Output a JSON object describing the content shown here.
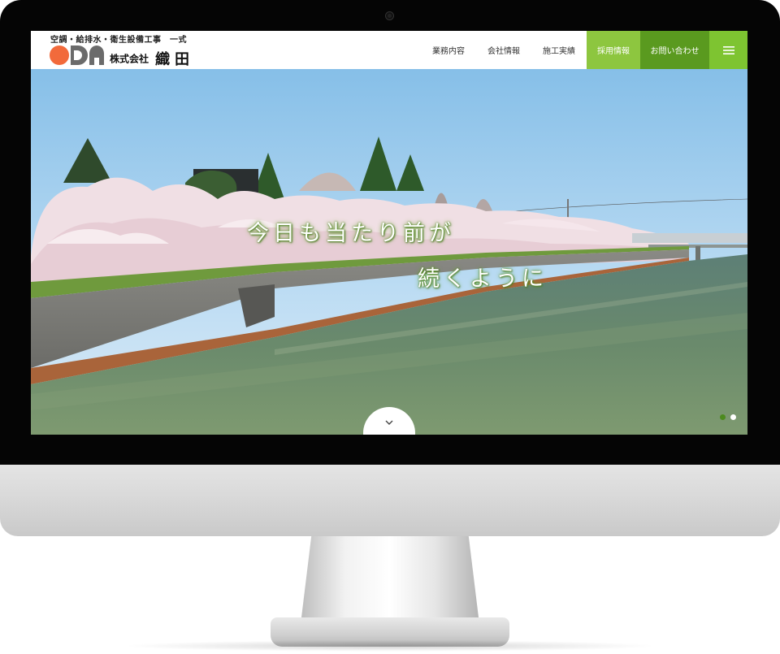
{
  "site": {
    "tagline": "空調・給排水・衛生設備工事　一式",
    "logo_text": "ODA",
    "company_prefix": "株式会社",
    "company_name": "織田"
  },
  "nav": {
    "items": [
      {
        "label": "業務内容"
      },
      {
        "label": "会社情報"
      },
      {
        "label": "施工実績"
      }
    ],
    "recruit_label": "採用情報",
    "contact_label": "お問い合わせ",
    "menu_icon": "hamburger-icon"
  },
  "hero": {
    "catch_line1": "今日も当たり前が",
    "catch_line2": "続くように",
    "scroll_icon": "chevron-down-icon",
    "slides": 2,
    "active_slide": 1
  },
  "colors": {
    "recruit_bg": "#8dc63f",
    "contact_bg": "#5a9a1f",
    "menu_bg": "#7ec431",
    "logo_orange": "#f26a3b",
    "logo_gray": "#6b6b6b",
    "dot_active": "#4c8a1e",
    "dot_inactive": "#ffffff"
  }
}
